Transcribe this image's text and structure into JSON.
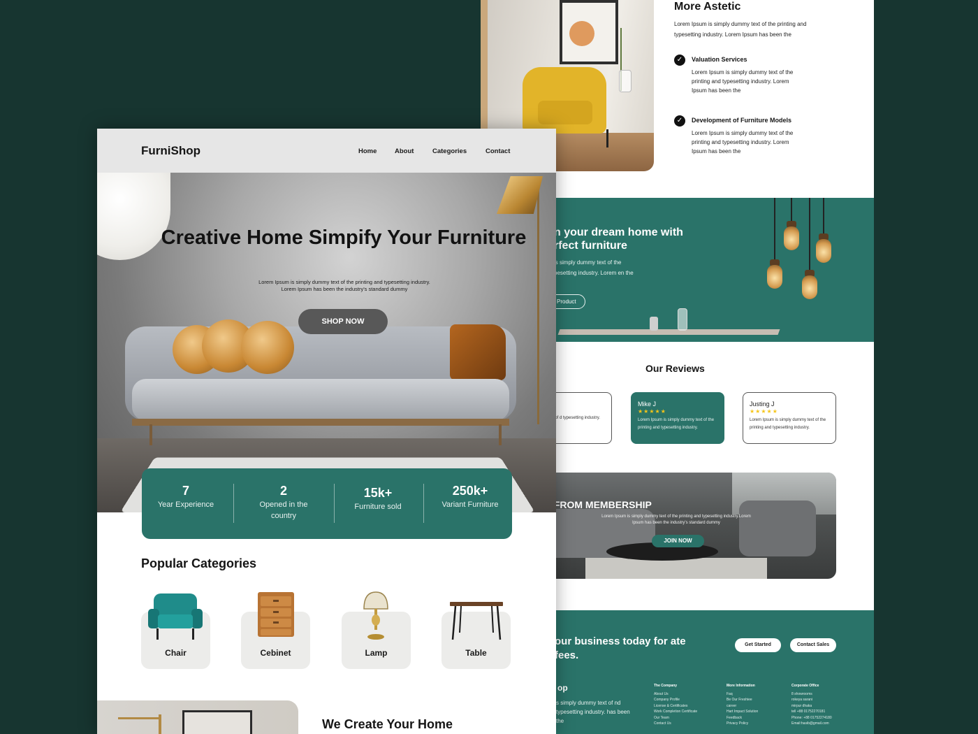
{
  "front": {
    "brand": "FurniShop",
    "nav": [
      "Home",
      "About",
      "Categories",
      "Contact"
    ],
    "hero": {
      "title": "Creative Home Simpify Your Furniture",
      "description": "Lorem Ipsum is simply dummy text of the printing and typesetting industry. Lorem Ipsum has been the industry's standard dummy",
      "cta": "SHOP NOW"
    },
    "stats": [
      {
        "value": "7",
        "label": "Year Experience"
      },
      {
        "value": "2",
        "label": "Opened in the country"
      },
      {
        "value": "15k+",
        "label": "Furniture sold"
      },
      {
        "value": "250k+",
        "label": "Variant Furniture"
      }
    ],
    "categories": {
      "title": "Popular Categories",
      "items": [
        "Chair",
        "Cebinet",
        "Lamp",
        "Table"
      ]
    },
    "section_title": "We Create Your Home"
  },
  "back": {
    "aesthetic": {
      "title": "More Astetic",
      "description": "Lorem Ipsum is simply dummy text of the printing and typesetting industry. Lorem Ipsum has been the"
    },
    "services": [
      {
        "title": "Valuation Services",
        "description": "Lorem Ipsum is simply dummy text of the printing and typesetting industry. Lorem Ipsum has been the"
      },
      {
        "title": "Development of Furniture Models",
        "description": "Lorem Ipsum is simply dummy text of the printing and typesetting industry. Lorem Ipsum has been the"
      }
    ],
    "banner": {
      "title": "n your dream home with rfect furniture",
      "description": "is simply dummy text of the pesetting industry. Lorem en the",
      "button": "Product"
    },
    "reviews": {
      "title": "Our Reviews",
      "items": [
        {
          "name": "",
          "stars": "",
          "text": "simply dummy text of d typesetting industry."
        },
        {
          "name": "Mike J",
          "stars": "★★★★★",
          "text": "Lorem Ipsum is simply dummy text of the printing and typesetting industry."
        },
        {
          "name": "Justing J",
          "stars": "★★★★★",
          "text": "Lorem Ipsum is simply dummy text of the printing and typesetting industry."
        }
      ]
    },
    "promo": {
      "title": "GET DISCOUNT FROM MEMBERSHIP",
      "description": "Lorem Ipsum is simply dummy text of the printing and typesetting industry.Lorem Ipsum has been the industry's standard dummy",
      "button": "JOIN NOW"
    },
    "footer": {
      "cta": "our business today for ate fees.",
      "get_started": "Get Started",
      "contact_sales": "Contact Sales",
      "brand": "op",
      "description": "s simply dummy text of nd typesetting industry. has been the",
      "columns": [
        {
          "heading": "The Company",
          "items": [
            "About Us",
            "Company Profile",
            "License & Certificates",
            "Work Completion Certificate",
            "Our Team",
            "Contact Us"
          ]
        },
        {
          "heading": "More Information",
          "items": [
            "Faq",
            "Be Our Freshiee",
            "career",
            "Hart Impact Solution",
            "Feedback",
            "Privacy Policy"
          ]
        },
        {
          "heading": "Corporate Office",
          "items": [
            "8 showrooms",
            "rokeya sarani",
            "mirpur dhaka",
            "tell +88 01752270181",
            "Phone: +88 01752274180",
            "Email:hasib@gmail.com"
          ]
        }
      ]
    }
  },
  "colors": {
    "background": "#173530",
    "accent": "#2a7369",
    "star": "#f5c518"
  }
}
